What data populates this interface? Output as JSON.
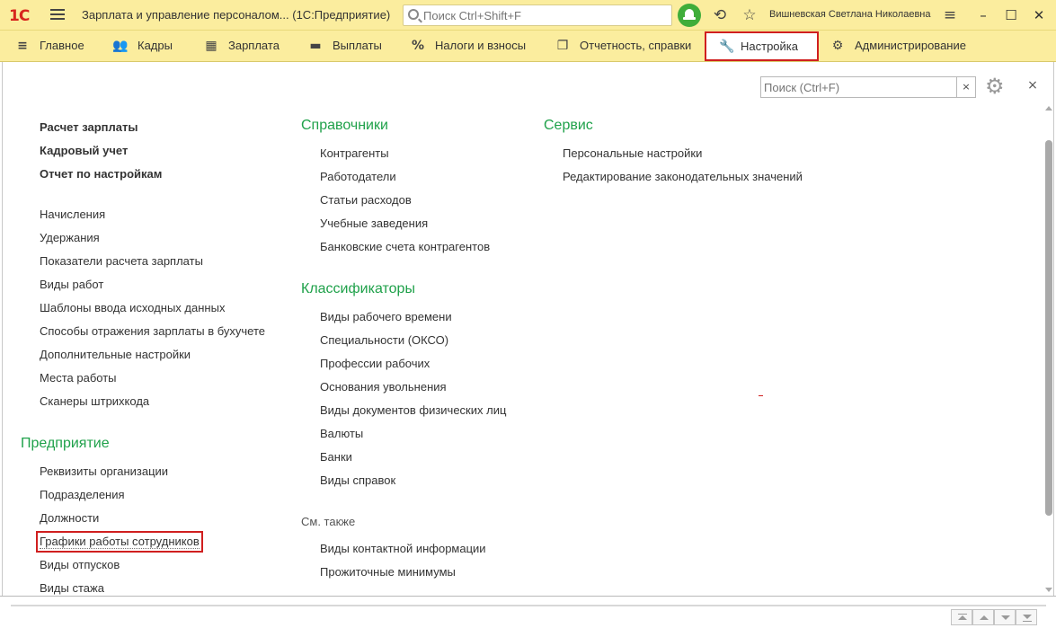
{
  "titlebar": {
    "logo": "1С",
    "title": "Зарплата и управление персоналом... (1С:Предприятие)",
    "search_placeholder": "Поиск Ctrl+Shift+F",
    "user": "Вишневская Светлана Николаевна",
    "history_icon": "⟲",
    "star_icon": "☆",
    "menu_icon": "≡",
    "minimize": "–",
    "maximize": "☐",
    "close": "✕"
  },
  "sections": [
    {
      "label": "Главное",
      "icon": "≡"
    },
    {
      "label": "Кадры",
      "icon": "👥"
    },
    {
      "label": "Зарплата",
      "icon": "▦"
    },
    {
      "label": "Выплаты",
      "icon": "▬"
    },
    {
      "label": "Налоги и взносы",
      "icon": "%"
    },
    {
      "label": "Отчетность, справки",
      "icon": "❐"
    },
    {
      "label": "Настройка",
      "icon": "🔧"
    },
    {
      "label": "Администрирование",
      "icon": "⚙"
    }
  ],
  "panel": {
    "search_placeholder": "Поиск (Ctrl+F)",
    "clear": "×",
    "gear": "⚙",
    "close": "×"
  },
  "col1": {
    "bold_items": [
      "Расчет зарплаты",
      "Кадровый учет",
      "Отчет по настройкам"
    ],
    "items": [
      "Начисления",
      "Удержания",
      "Показатели расчета зарплаты",
      "Виды работ",
      "Шаблоны ввода исходных данных",
      "Способы отражения зарплаты в бухучете",
      "Дополнительные настройки",
      "Места работы",
      "Сканеры штрихкода"
    ],
    "enterprise_header": "Предприятие",
    "enterprise_items": [
      "Реквизиты организации",
      "Подразделения",
      "Должности",
      "Графики работы сотрудников",
      "Виды отпусков",
      "Виды стажа"
    ]
  },
  "col2": {
    "references_header": "Справочники",
    "references_items": [
      "Контрагенты",
      "Работодатели",
      "Статьи расходов",
      "Учебные заведения",
      "Банковские счета контрагентов"
    ],
    "classifiers_header": "Классификаторы",
    "classifiers_items": [
      "Виды рабочего времени",
      "Специальности (ОКСО)",
      "Профессии рабочих",
      "Основания увольнения",
      "Виды документов физических лиц",
      "Валюты",
      "Банки",
      "Виды справок"
    ],
    "see_also_header": "См. также",
    "see_also_items": [
      "Виды контактной информации",
      "Прожиточные минимумы"
    ]
  },
  "col3": {
    "service_header": "Сервис",
    "service_items": [
      "Персональные настройки",
      "Редактирование законодательных значений"
    ]
  }
}
